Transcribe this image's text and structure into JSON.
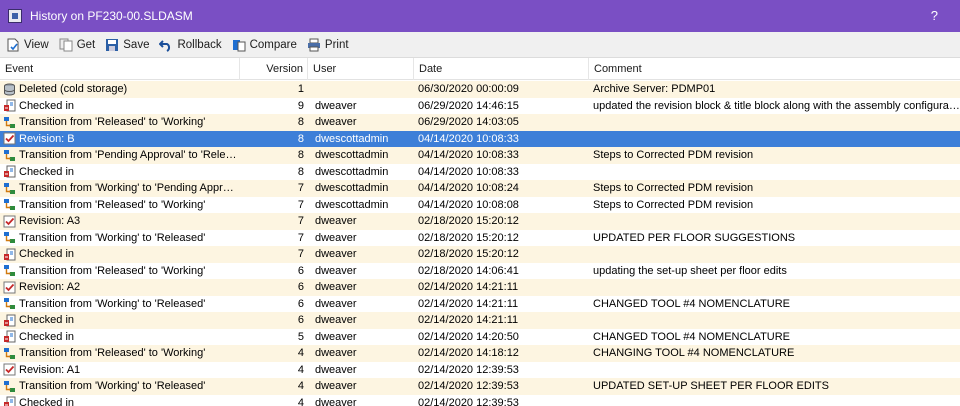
{
  "window": {
    "title": "History on PF230-00.SLDASM",
    "help": "?"
  },
  "toolbar": {
    "items": [
      {
        "label": "View",
        "icon": "view-icon"
      },
      {
        "label": "Get",
        "icon": "get-icon"
      },
      {
        "label": "Save",
        "icon": "save-icon"
      },
      {
        "label": "Rollback",
        "icon": "rollback-icon"
      },
      {
        "label": "Compare",
        "icon": "compare-icon"
      },
      {
        "label": "Print",
        "icon": "print-icon"
      }
    ]
  },
  "columns": {
    "event": "Event",
    "version": "Version",
    "user": "User",
    "date": "Date",
    "comment": "Comment"
  },
  "colors": {
    "title_bar": "#7a4fc4",
    "selected_row": "#3d7fd8",
    "alt_row": "#fdf5e1"
  },
  "rows": [
    {
      "icon": "cold-storage-icon",
      "event": "Deleted (cold storage)",
      "version": "1",
      "user": "",
      "date": "06/30/2020 00:00:09",
      "comment": "Archive Server: PDMP01"
    },
    {
      "icon": "checkin-icon",
      "event": "Checked in",
      "version": "9",
      "user": "dweaver",
      "date": "06/29/2020 14:46:15",
      "comment": "updated the revision block & title block along with the assembly configuration"
    },
    {
      "icon": "transition-icon",
      "event": "Transition from 'Released' to 'Working'",
      "version": "8",
      "user": "dweaver",
      "date": "06/29/2020 14:03:05",
      "comment": ""
    },
    {
      "icon": "revision-icon",
      "event": "Revision: B",
      "version": "8",
      "user": "dwescottadmin",
      "date": "04/14/2020 10:08:33",
      "comment": "",
      "selected": true
    },
    {
      "icon": "transition-icon",
      "event": "Transition from 'Pending Approval' to 'Relea...",
      "version": "8",
      "user": "dwescottadmin",
      "date": "04/14/2020 10:08:33",
      "comment": "Steps to Corrected PDM revision"
    },
    {
      "icon": "checkin-icon",
      "event": "Checked in",
      "version": "8",
      "user": "dwescottadmin",
      "date": "04/14/2020 10:08:33",
      "comment": ""
    },
    {
      "icon": "transition-icon",
      "event": "Transition from 'Working' to 'Pending Approval'",
      "version": "7",
      "user": "dwescottadmin",
      "date": "04/14/2020 10:08:24",
      "comment": "Steps to Corrected PDM revision"
    },
    {
      "icon": "transition-icon",
      "event": "Transition from 'Released' to 'Working'",
      "version": "7",
      "user": "dwescottadmin",
      "date": "04/14/2020 10:08:08",
      "comment": "Steps to Corrected PDM revision"
    },
    {
      "icon": "revision-icon",
      "event": "Revision: A3",
      "version": "7",
      "user": "dweaver",
      "date": "02/18/2020 15:20:12",
      "comment": ""
    },
    {
      "icon": "transition-icon",
      "event": "Transition from 'Working' to 'Released'",
      "version": "7",
      "user": "dweaver",
      "date": "02/18/2020 15:20:12",
      "comment": "UPDATED PER FLOOR SUGGESTIONS"
    },
    {
      "icon": "checkin-icon",
      "event": "Checked in",
      "version": "7",
      "user": "dweaver",
      "date": "02/18/2020 15:20:12",
      "comment": ""
    },
    {
      "icon": "transition-icon",
      "event": "Transition from 'Released' to 'Working'",
      "version": "6",
      "user": "dweaver",
      "date": "02/18/2020 14:06:41",
      "comment": "updating the set-up sheet per floor edits"
    },
    {
      "icon": "revision-icon",
      "event": "Revision: A2",
      "version": "6",
      "user": "dweaver",
      "date": "02/14/2020 14:21:11",
      "comment": ""
    },
    {
      "icon": "transition-icon",
      "event": "Transition from 'Working' to 'Released'",
      "version": "6",
      "user": "dweaver",
      "date": "02/14/2020 14:21:11",
      "comment": "CHANGED TOOL #4 NOMENCLATURE"
    },
    {
      "icon": "checkin-icon",
      "event": "Checked in",
      "version": "6",
      "user": "dweaver",
      "date": "02/14/2020 14:21:11",
      "comment": ""
    },
    {
      "icon": "checkin-icon",
      "event": "Checked in",
      "version": "5",
      "user": "dweaver",
      "date": "02/14/2020 14:20:50",
      "comment": "CHANGED TOOL #4 NOMENCLATURE"
    },
    {
      "icon": "transition-icon",
      "event": "Transition from 'Released' to 'Working'",
      "version": "4",
      "user": "dweaver",
      "date": "02/14/2020 14:18:12",
      "comment": "CHANGING TOOL #4 NOMENCLATURE"
    },
    {
      "icon": "revision-icon",
      "event": "Revision: A1",
      "version": "4",
      "user": "dweaver",
      "date": "02/14/2020 12:39:53",
      "comment": ""
    },
    {
      "icon": "transition-icon",
      "event": "Transition from 'Working' to 'Released'",
      "version": "4",
      "user": "dweaver",
      "date": "02/14/2020 12:39:53",
      "comment": "UPDATED SET-UP SHEET PER FLOOR EDITS"
    },
    {
      "icon": "checkin-icon",
      "event": "Checked in",
      "version": "4",
      "user": "dweaver",
      "date": "02/14/2020 12:39:53",
      "comment": ""
    }
  ]
}
